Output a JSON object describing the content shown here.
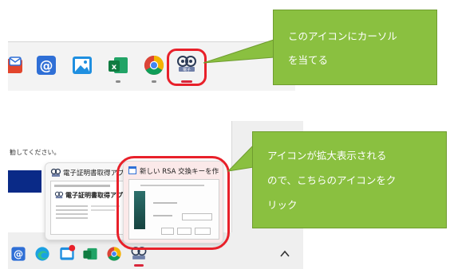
{
  "callout_top": {
    "line1": "このアイコンにカーソル",
    "line2": "を当てる"
  },
  "callout_bottom": {
    "line1": "アイコンが拡大表示される",
    "line2": "ので、こちらのアイコンをク",
    "line3": "リック"
  },
  "bottom_screen": {
    "page_text": "勧してください。",
    "thumb_left_title": "電子証明書取得アプ...",
    "thumb_left_inner_title": "電子証明書取得アプ",
    "thumb_right_title": "新しい RSA 交換キーを作..."
  },
  "colors": {
    "callout_fill": "#8ac040",
    "highlight_ring": "#e8202a",
    "active_indicator": "#d9263a"
  },
  "icons": [
    "mail-icon",
    "at-sign-icon",
    "photos-icon",
    "excel-icon",
    "chrome-icon",
    "certificate-app-icon",
    "edge-icon",
    "store-icon",
    "chevron-up-icon"
  ]
}
